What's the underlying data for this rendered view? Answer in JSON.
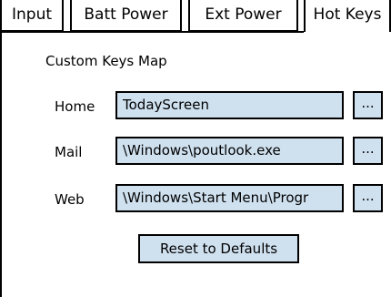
{
  "tabs": [
    {
      "label": "Input",
      "active": false
    },
    {
      "label": "Batt Power",
      "active": false
    },
    {
      "label": "Ext Power",
      "active": false
    },
    {
      "label": "Hot Keys",
      "active": true
    }
  ],
  "section_title": "Custom Keys Map",
  "rows": [
    {
      "label": "Home",
      "value": "TodayScreen",
      "browse_label": "..."
    },
    {
      "label": "Mail",
      "value": "\\Windows\\poutlook.exe",
      "browse_label": "..."
    },
    {
      "label": "Web",
      "value": "\\Windows\\Start Menu\\Progr",
      "browse_label": "..."
    }
  ],
  "reset_button_label": "Reset to Defaults",
  "colors": {
    "field_bg": "#cfe0ef",
    "border": "#000000",
    "background": "#ffffff"
  }
}
